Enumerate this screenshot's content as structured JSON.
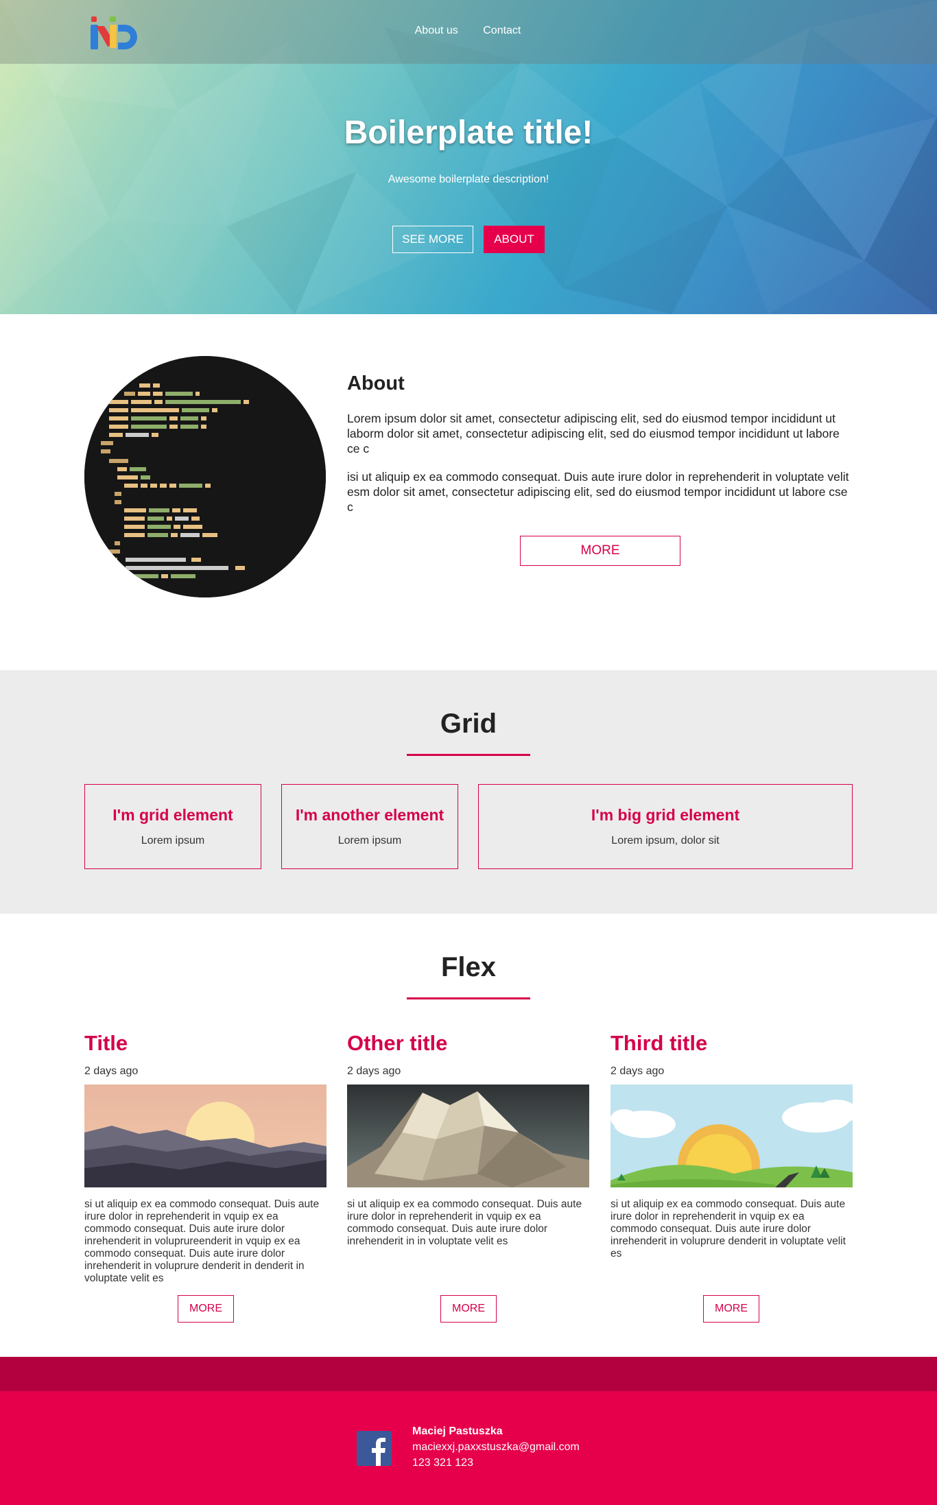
{
  "nav": {
    "items": [
      "About us",
      "Contact"
    ]
  },
  "hero": {
    "title": "Boilerplate title!",
    "description": "Awesome boilerplate description!",
    "see_more_label": "SEE MORE",
    "about_label": "ABOUT"
  },
  "about": {
    "title": "About",
    "p1": "Lorem ipsum dolor sit amet, consectetur adipiscing elit, sed do eiusmod tempor incididunt ut laborm dolor sit amet, consectetur adipiscing elit, sed do eiusmod tempor incididunt ut labore ce c",
    "p2": "isi ut aliquip ex ea commodo consequat. Duis aute irure dolor in reprehenderit in voluptate velit esm dolor sit amet, consectetur adipiscing elit, sed do eiusmod tempor incididunt ut labore cse c",
    "more_label": "MORE",
    "image_icon": "code-image"
  },
  "grid": {
    "title": "Grid",
    "cards": [
      {
        "title": "I'm grid element",
        "text": "Lorem ipsum"
      },
      {
        "title": "I'm another element",
        "text": "Lorem ipsum"
      },
      {
        "title": "I'm big grid element",
        "text": "Lorem ipsum, dolor sit"
      }
    ]
  },
  "flex": {
    "title": "Flex",
    "items": [
      {
        "title": "Title",
        "date": "2 days ago",
        "image": "sunset-mountains",
        "text": "si ut aliquip ex ea commodo consequat. Duis aute irure dolor in reprehenderit in vquip ex ea commodo consequat. Duis aute irure dolor inrehenderit in voluprureenderit in vquip ex ea commodo consequat. Duis aute irure dolor inrehenderit in voluprure denderit in denderit in voluptate velit es",
        "more_label": "MORE"
      },
      {
        "title": "Other title",
        "date": "2 days ago",
        "image": "low-poly-mountain",
        "text": "si ut aliquip ex ea commodo consequat. Duis aute irure dolor in reprehenderit in vquip ex ea commodo consequat. Duis aute irure dolor inrehenderit in in voluptate velit es",
        "more_label": "MORE"
      },
      {
        "title": "Third title",
        "date": "2 days ago",
        "image": "sunny-hills",
        "text": "si ut aliquip ex ea commodo consequat. Duis aute irure dolor in reprehenderit in vquip ex ea commodo consequat. Duis aute irure dolor inrehenderit in voluprure denderit in voluptate velit es",
        "more_label": "MORE"
      }
    ]
  },
  "footer": {
    "name": "Maciej Pastuszka",
    "email": "maciexxj.paxxstuszka@gmail.com",
    "phone": "123 321 123",
    "social_icon": "facebook-icon"
  },
  "colors": {
    "accent": "#e6004c",
    "accent_dark": "#b3003e",
    "grid_bg": "#ececec"
  }
}
